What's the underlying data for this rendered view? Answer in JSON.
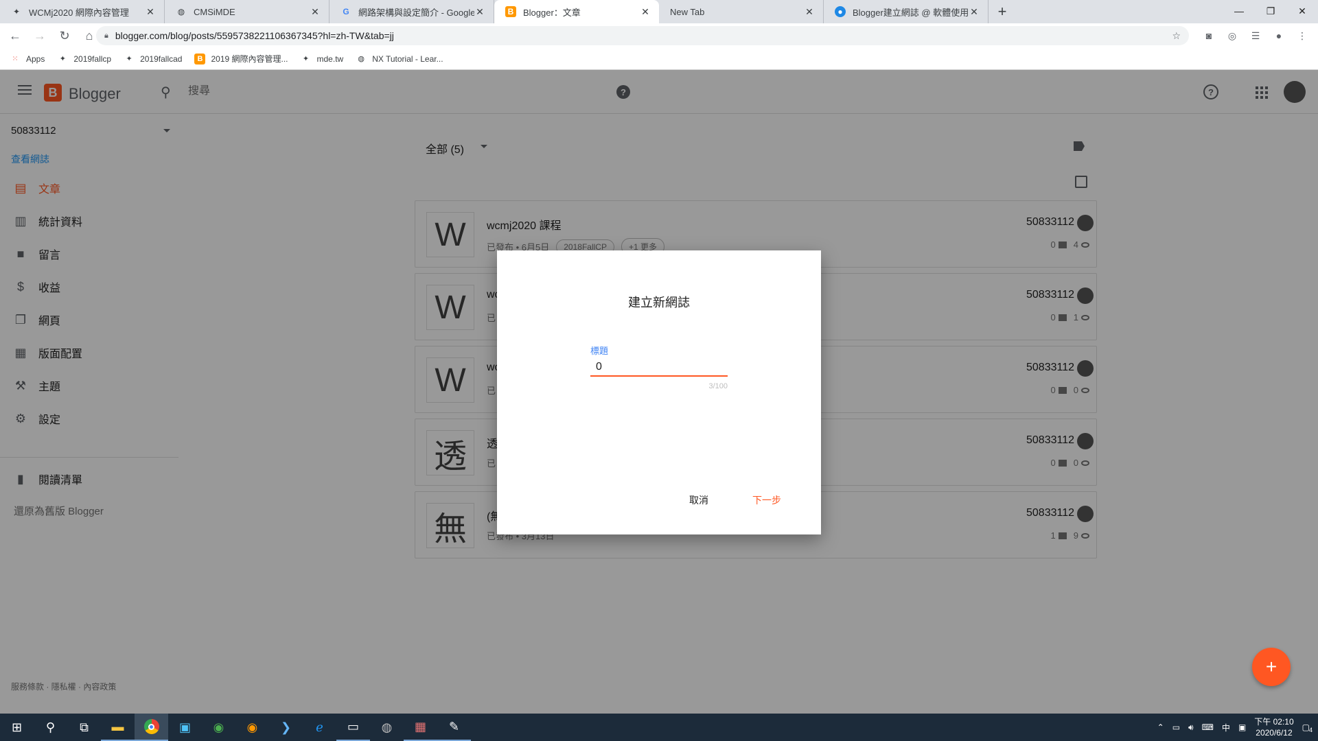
{
  "browser": {
    "tabs": [
      {
        "title": "WCMj2020 網際內容管理",
        "icon": "w"
      },
      {
        "title": "CMSiMDE",
        "icon": "globe"
      },
      {
        "title": "網路架構與設定簡介 - Google 搜",
        "icon": "g"
      },
      {
        "title": "Blogger：文章",
        "icon": "b"
      },
      {
        "title": "New Tab",
        "icon": ""
      },
      {
        "title": "Blogger建立網誌 @ 軟體使用教",
        "icon": "p"
      }
    ],
    "url": "blogger.com/blog/posts/5595738221106367345?hl=zh-TW&tab=jj",
    "bookmarks": [
      "Apps",
      "2019fallcp",
      "2019fallcad",
      "2019 網際內容管理...",
      "mde.tw",
      "NX Tutorial - Lear..."
    ]
  },
  "header": {
    "brand": "Blogger",
    "search_placeholder": "搜尋"
  },
  "sidebar": {
    "blog_name": "50833112",
    "view_blog": "查看網誌",
    "items": [
      {
        "label": "文章",
        "icon": "posts-icon",
        "glyph": "▤",
        "active": true
      },
      {
        "label": "統計資料",
        "icon": "stats-icon",
        "glyph": "▥"
      },
      {
        "label": "留言",
        "icon": "comments-icon",
        "glyph": "■"
      },
      {
        "label": "收益",
        "icon": "earnings-icon",
        "glyph": "$"
      },
      {
        "label": "網頁",
        "icon": "pages-icon",
        "glyph": "❐"
      },
      {
        "label": "版面配置",
        "icon": "layout-icon",
        "glyph": "▦"
      },
      {
        "label": "主題",
        "icon": "theme-icon",
        "glyph": "⚒"
      },
      {
        "label": "設定",
        "icon": "settings-icon",
        "glyph": "⚙"
      }
    ],
    "reading_list": "閱讀清單",
    "legacy": "還原為舊版 Blogger",
    "footer": "服務條款 · 隱私權 · 內容政策"
  },
  "main": {
    "filter": "全部 (5)",
    "posts": [
      {
        "thumb": "W",
        "title": "wcmj2020 課程",
        "meta": "已發布 • 6月5日",
        "labels": [
          "2018FallCP",
          "+1 更多"
        ],
        "author": "50833112",
        "comments": "0",
        "views": "4"
      },
      {
        "thumb": "W",
        "title": "wc",
        "meta": "已",
        "labels": [],
        "author": "50833112",
        "comments": "0",
        "views": "1"
      },
      {
        "thumb": "W",
        "title": "wc",
        "meta": "已",
        "labels": [],
        "author": "50833112",
        "comments": "0",
        "views": "0"
      },
      {
        "thumb": "透",
        "title": "透",
        "meta": "已",
        "labels": [],
        "author": "50833112",
        "comments": "0",
        "views": "0"
      },
      {
        "thumb": "無",
        "title": "(無",
        "meta": "已發布 • 3月13日",
        "labels": [],
        "author": "50833112",
        "comments": "1",
        "views": "9"
      }
    ]
  },
  "dialog": {
    "title": "建立新網誌",
    "field_label": "標題",
    "field_value": "0",
    "counter": "3/100",
    "cancel": "取消",
    "next": "下一步"
  },
  "taskbar": {
    "time": "下午 02:10",
    "date": "2020/6/12",
    "ime": "中",
    "notifications": "4"
  },
  "colors": {
    "accent": "#ff5722",
    "link": "#2196f3",
    "focus_label": "#4285f4"
  }
}
